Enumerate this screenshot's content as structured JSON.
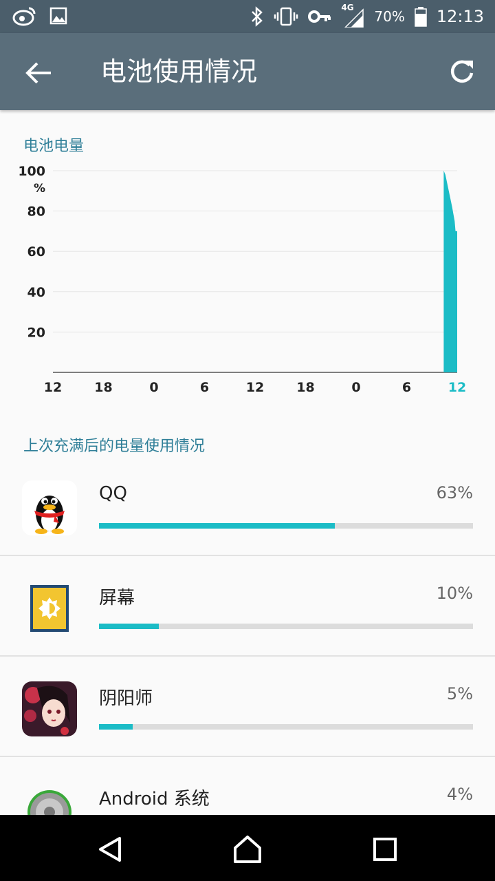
{
  "status_bar": {
    "network": "4G",
    "battery": "70%",
    "time": "12:13"
  },
  "app_bar": {
    "title": "电池使用情况"
  },
  "battery_level": {
    "title": "电池电量"
  },
  "chart_data": {
    "type": "area",
    "y_ticks": [
      "100",
      "80",
      "60",
      "40",
      "20"
    ],
    "y_unit": "%",
    "x_ticks": [
      "12",
      "18",
      "0",
      "6",
      "12",
      "18",
      "0",
      "6",
      "12"
    ],
    "highlighted_x_tick": 8,
    "ylim": [
      0,
      100
    ],
    "xlim_hours": [
      0,
      48
    ],
    "grid": true,
    "series": [
      {
        "color": "#1bbcc6",
        "points": [
          [
            46.4,
            100
          ],
          [
            46.6,
            98
          ],
          [
            47.0,
            90
          ],
          [
            47.4,
            82
          ],
          [
            47.7,
            75
          ],
          [
            47.8,
            70
          ],
          [
            48.0,
            70
          ]
        ]
      }
    ]
  },
  "usage": {
    "title": "上次充满后的电量使用情况",
    "apps": [
      {
        "name": "QQ",
        "percent": "63%",
        "fraction": 0.63,
        "icon": "qq-penguin-icon"
      },
      {
        "name": "屏幕",
        "percent": "10%",
        "fraction": 0.16,
        "icon": "screen-brightness-icon"
      },
      {
        "name": "阴阳师",
        "percent": "5%",
        "fraction": 0.09,
        "icon": "onmyoji-game-icon"
      },
      {
        "name": "Android 系统",
        "percent": "4%",
        "fraction": 0.07,
        "icon": "android-system-icon"
      }
    ]
  },
  "colors": {
    "status_bar": "#4b5e6b",
    "app_bar": "#5a6e7b",
    "accent": "#1bbcc6",
    "section_title": "#2f7f98"
  }
}
